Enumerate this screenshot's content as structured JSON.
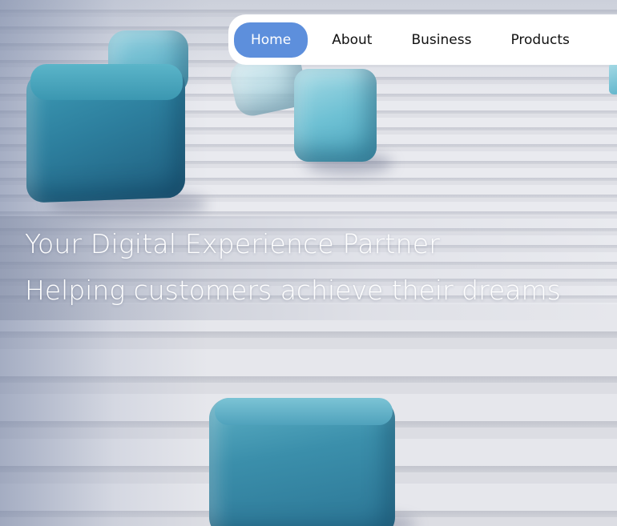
{
  "nav": {
    "items": [
      {
        "label": "Home",
        "active": true
      },
      {
        "label": "About",
        "active": false
      },
      {
        "label": "Business",
        "active": false
      },
      {
        "label": "Products",
        "active": false
      }
    ]
  },
  "hero": {
    "headline": "Your Digital Experience Partner",
    "subline": "Helping customers achieve their dreams",
    "background": "staircase-with-cubes-image"
  },
  "colors": {
    "accent": "#5d8fdc",
    "nav_bg": "#ffffff",
    "hero_text": "#ffffff",
    "cube_teal": "#2d7f9e"
  }
}
